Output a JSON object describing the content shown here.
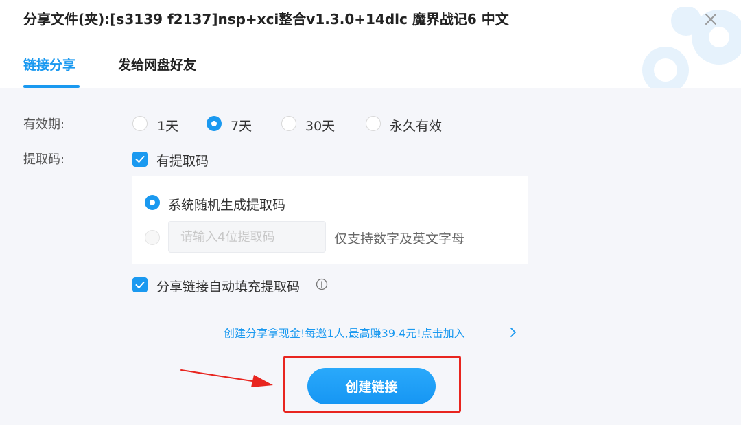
{
  "dialog": {
    "title": "分享文件(夹):[s3139 f2137]nsp+xci整合v1.3.0+14dlc 魔界战记6 中文"
  },
  "tabs": [
    {
      "label": "链接分享",
      "active": true
    },
    {
      "label": "发给网盘好友",
      "active": false
    }
  ],
  "validity": {
    "label": "有效期:",
    "options": [
      "1天",
      "7天",
      "30天",
      "永久有效"
    ],
    "selected": "7天"
  },
  "extract_code": {
    "label": "提取码:",
    "has_code_label": "有提取码",
    "has_code_checked": true,
    "random_option_label": "系统随机生成提取码",
    "random_selected": true,
    "custom_input_placeholder": "请输入4位提取码",
    "custom_hint": "仅支持数字及英文字母"
  },
  "auto_fill": {
    "label": "分享链接自动填充提取码",
    "checked": true
  },
  "promo": {
    "text": "创建分享拿现金!每邀1人,最高赚39.4元!点击加入"
  },
  "create_button": {
    "label": "创建链接"
  },
  "colors": {
    "accent": "#1a99f0",
    "background": "#f5f6fa",
    "highlight_red": "#e8251f"
  },
  "icons": [
    "close-icon",
    "cloud-logo-icon",
    "check-icon",
    "info-icon",
    "chevron-right-icon",
    "arrow-annotation-icon"
  ]
}
